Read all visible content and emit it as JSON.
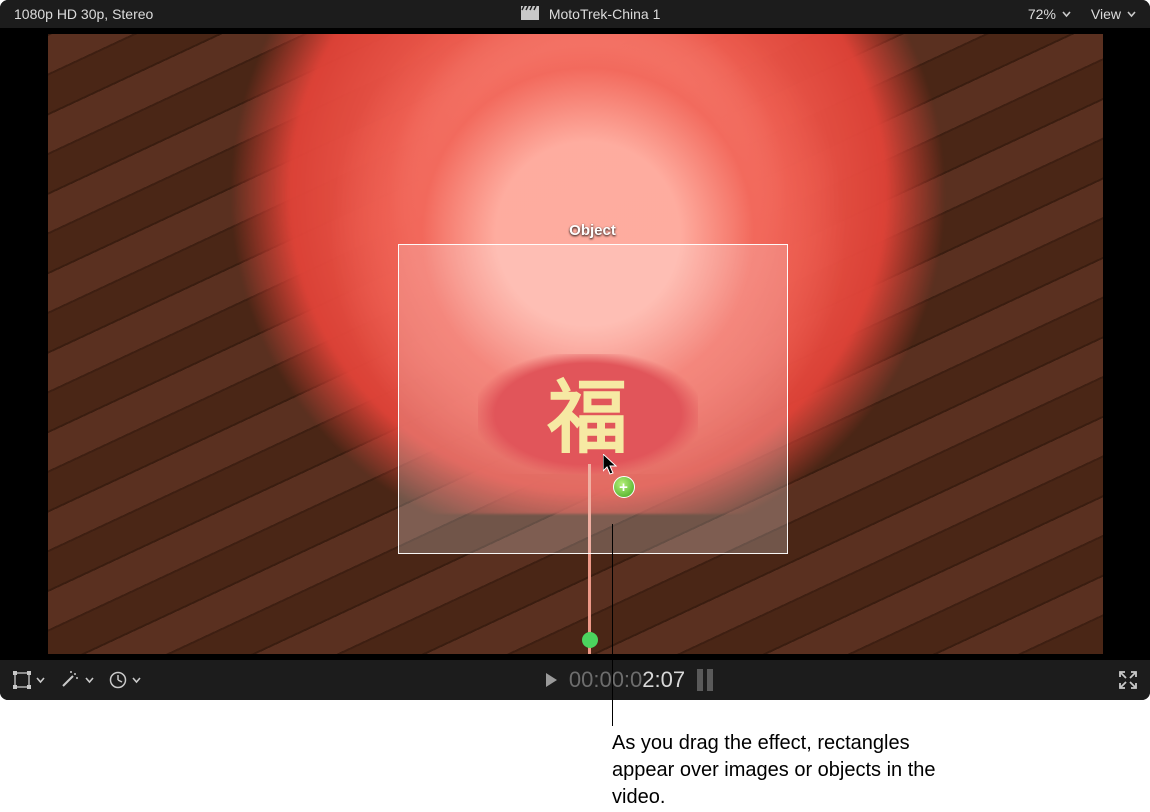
{
  "topbar": {
    "format": "1080p HD 30p, Stereo",
    "project": "MotoTrek-China 1",
    "zoom": "72%",
    "view_label": "View"
  },
  "selection": {
    "label": "Object"
  },
  "timebar": {
    "dim": "00:00:0",
    "bright": "2:07"
  },
  "icons": {
    "clapper": "clapperboard-icon",
    "transform": "transform-icon",
    "wand": "magic-wand-icon",
    "retime": "retime-icon",
    "fullscreen": "fullscreen-icon",
    "play": "play-icon",
    "pause": "pause-icon",
    "chevron": "chevron-down-icon",
    "cursor": "cursor-icon",
    "plus": "plus-add-icon"
  },
  "annotation": {
    "text": "As you drag the effect, rectangles appear over images or objects in the video."
  }
}
